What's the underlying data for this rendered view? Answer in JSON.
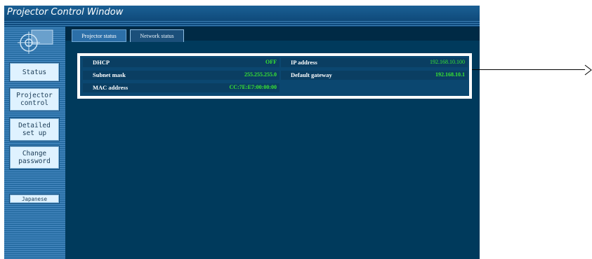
{
  "window": {
    "title": "Projector Control Window"
  },
  "sidebar": {
    "status_label": "Status",
    "projector_label": "Projector\ncontrol",
    "detailed_label": "Detailed\nset up",
    "password_label": "Change\npassword",
    "japanese_label": "Japanese"
  },
  "tabs": {
    "projector_status": "Projector status",
    "network_status": "Network status"
  },
  "network": {
    "dhcp": {
      "label": "DHCP",
      "value": "OFF"
    },
    "subnet_mask": {
      "label": "Subnet mask",
      "value": "255.255.255.0"
    },
    "mac_address": {
      "label": "MAC address",
      "value": "CC:7E:E7:00:00:00"
    },
    "ip_address": {
      "label": "IP address",
      "value": "192.168.10.100"
    },
    "default_gateway": {
      "label": "Default gateway",
      "value": "192.168.10.1"
    }
  },
  "colors": {
    "value_green": "#39e631",
    "background": "#003a5c",
    "highlight_border": "#ffffff"
  }
}
